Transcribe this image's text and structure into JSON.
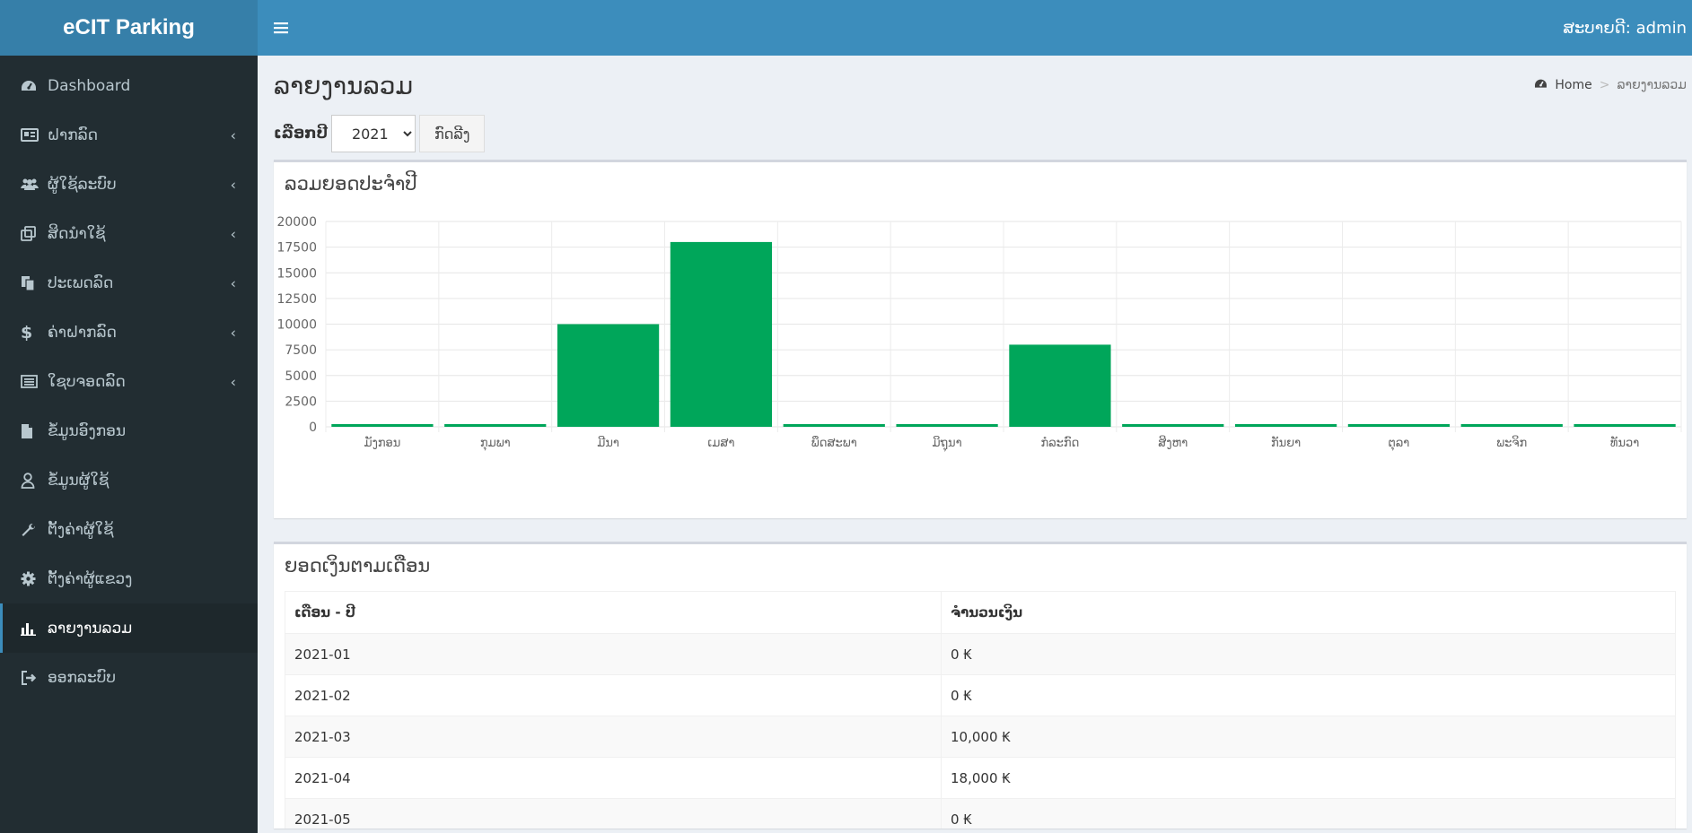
{
  "app": {
    "title": "eCIT Parking"
  },
  "header": {
    "user_text": "ສະບາຍດີ: admin"
  },
  "sidebar": {
    "items": [
      {
        "label": "Dashboard",
        "icon": "dashboard-icon",
        "has_children": false,
        "active": false
      },
      {
        "label": "ຝາກລົດ",
        "icon": "id-card-icon",
        "has_children": true,
        "active": false
      },
      {
        "label": "ຜູ້ໃຊ້ລະບົບ",
        "icon": "users-icon",
        "has_children": true,
        "active": false
      },
      {
        "label": "ສິດນຳໃຊ້",
        "icon": "clone-icon",
        "has_children": true,
        "active": false
      },
      {
        "label": "ປະເພດລົດ",
        "icon": "copy-icon",
        "has_children": true,
        "active": false
      },
      {
        "label": "ຄ່າຝາກລົດ",
        "icon": "dollar-icon",
        "has_children": true,
        "active": false
      },
      {
        "label": "ໃຊບຈອດລົດ",
        "icon": "list-alt-icon",
        "has_children": true,
        "active": false
      },
      {
        "label": "ຂໍ້ມູນອົງກອນ",
        "icon": "file-icon",
        "has_children": false,
        "active": false
      },
      {
        "label": "ຂໍ້ມູນຜູ້ໃຊ້",
        "icon": "user-icon",
        "has_children": false,
        "active": false
      },
      {
        "label": "ຕັ້ງຄ່າຜູ້ໃຊ້",
        "icon": "wrench-icon",
        "has_children": false,
        "active": false
      },
      {
        "label": "ຕັ້ງຄ່າຜູ້ແຂວງ",
        "icon": "gear-icon",
        "has_children": false,
        "active": false
      },
      {
        "label": "ລາຍງານລວມ",
        "icon": "bar-chart-icon",
        "has_children": false,
        "active": true
      },
      {
        "label": "ອອກລະບົບ",
        "icon": "sign-out-icon",
        "has_children": false,
        "active": false
      }
    ]
  },
  "page": {
    "title": "ລາຍງານລວມ",
    "breadcrumb": {
      "home": "Home",
      "current": "ລາຍງານລວມ"
    }
  },
  "filter": {
    "label": "ເລືອກປີ",
    "selected_year": "2021",
    "button_label": "ກົດລີງ"
  },
  "chart_box": {
    "title": "ລວມຍອດປະຈຳປີ"
  },
  "chart_data": {
    "type": "bar",
    "categories": [
      "ມັງກອນ",
      "ກຸມພາ",
      "ມີນາ",
      "ເມສາ",
      "ພຶດສະພາ",
      "ມິຖຸນາ",
      "ກໍລະກົດ",
      "ສິງຫາ",
      "ກັນຍາ",
      "ຕຸລາ",
      "ພະຈິກ",
      "ທັນວາ"
    ],
    "values": [
      0,
      0,
      10000,
      18000,
      0,
      0,
      8000,
      0,
      0,
      0,
      0,
      0
    ],
    "ylim": [
      0,
      20000
    ],
    "yticks": [
      "0",
      "2500",
      "5000",
      "7500",
      "10000",
      "12500",
      "15000",
      "17500",
      "20000"
    ],
    "bar_color": "#00a65a",
    "grid": true,
    "title": "",
    "xlabel": "",
    "ylabel": ""
  },
  "table_box": {
    "title": "ຍອດເງິນຕາມເດືອນ",
    "headers": [
      "ເດືອນ - ປີ",
      "ຈຳນວນເງິນ"
    ],
    "rows": [
      [
        "2021-01",
        "0 ₭"
      ],
      [
        "2021-02",
        "0 ₭"
      ],
      [
        "2021-03",
        "10,000 ₭"
      ],
      [
        "2021-04",
        "18,000 ₭"
      ],
      [
        "2021-05",
        "0 ₭"
      ]
    ]
  },
  "colors": {
    "sidebar_bg": "#222d32",
    "header_bg": "#3c8dbc",
    "logo_bg": "#367fa9",
    "content_bg": "#ecf0f5",
    "bar": "#00a65a"
  }
}
